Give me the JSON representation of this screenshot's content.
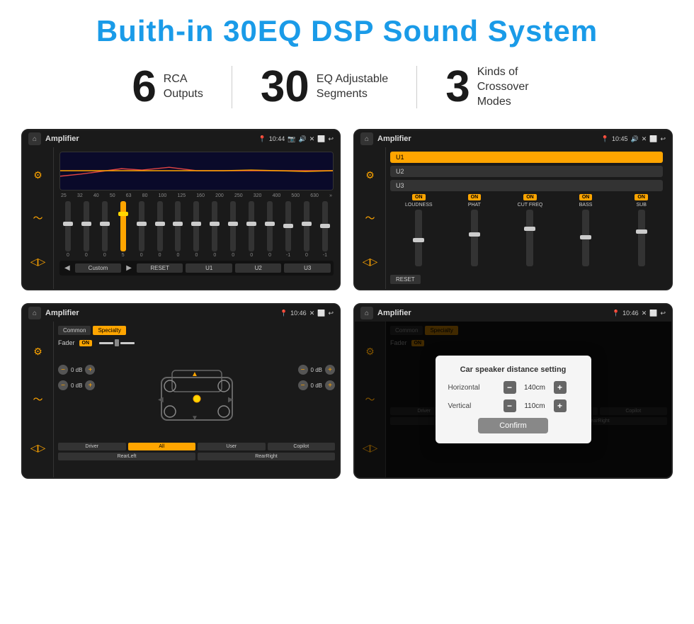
{
  "page": {
    "title": "Buith-in 30EQ DSP Sound System",
    "stats": [
      {
        "number": "6",
        "label": "RCA\nOutputs"
      },
      {
        "number": "30",
        "label": "EQ Adjustable\nSegments"
      },
      {
        "number": "3",
        "label": "Kinds of\nCrossover Modes"
      }
    ],
    "screens": [
      {
        "id": "eq-screen",
        "status_bar": {
          "title": "Amplifier",
          "time": "10:44",
          "icons": "📍 ☁ 🔊 ✕ ⬜ ↩"
        },
        "type": "equalizer"
      },
      {
        "id": "crossover-screen",
        "status_bar": {
          "title": "Amplifier",
          "time": "10:45",
          "icons": "📍 ● 🔊 ✕ ⬜ ↩"
        },
        "type": "crossover"
      },
      {
        "id": "settings-screen",
        "status_bar": {
          "title": "Amplifier",
          "time": "10:46",
          "icons": "📍 ● ✕ ⬜ ↩"
        },
        "type": "fader"
      },
      {
        "id": "distance-screen",
        "status_bar": {
          "title": "Amplifier",
          "time": "10:46",
          "icons": "📍 ● ✕ ⬜ ↩"
        },
        "type": "distance",
        "dialog": {
          "title": "Car speaker distance setting",
          "horizontal_label": "Horizontal",
          "horizontal_value": "140cm",
          "vertical_label": "Vertical",
          "vertical_value": "110cm",
          "confirm_label": "Confirm"
        }
      }
    ],
    "eq": {
      "freqs": [
        "25",
        "32",
        "40",
        "50",
        "63",
        "80",
        "100",
        "125",
        "160",
        "200",
        "250",
        "320",
        "400",
        "500",
        "630"
      ],
      "values": [
        "0",
        "0",
        "0",
        "5",
        "0",
        "0",
        "0",
        "0",
        "0",
        "0",
        "0",
        "0",
        "-1",
        "0",
        "-1"
      ],
      "presets": [
        "Custom",
        "RESET",
        "U1",
        "U2",
        "U3"
      ]
    },
    "crossover": {
      "tabs": [
        "U1",
        "U2",
        "U3"
      ],
      "channels": [
        "LOUDNESS",
        "PHAT",
        "CUT FREQ",
        "BASS",
        "SUB"
      ],
      "on_labels": [
        "ON",
        "ON",
        "ON",
        "ON",
        "ON"
      ]
    },
    "fader": {
      "tabs": [
        "Common",
        "Specialty"
      ],
      "fader_label": "Fader",
      "fader_on": "ON",
      "db_values": [
        "0 dB",
        "0 dB",
        "0 dB",
        "0 dB"
      ],
      "buttons": [
        "Driver",
        "Copilot",
        "RearLeft",
        "All",
        "User",
        "RearRight"
      ]
    }
  }
}
